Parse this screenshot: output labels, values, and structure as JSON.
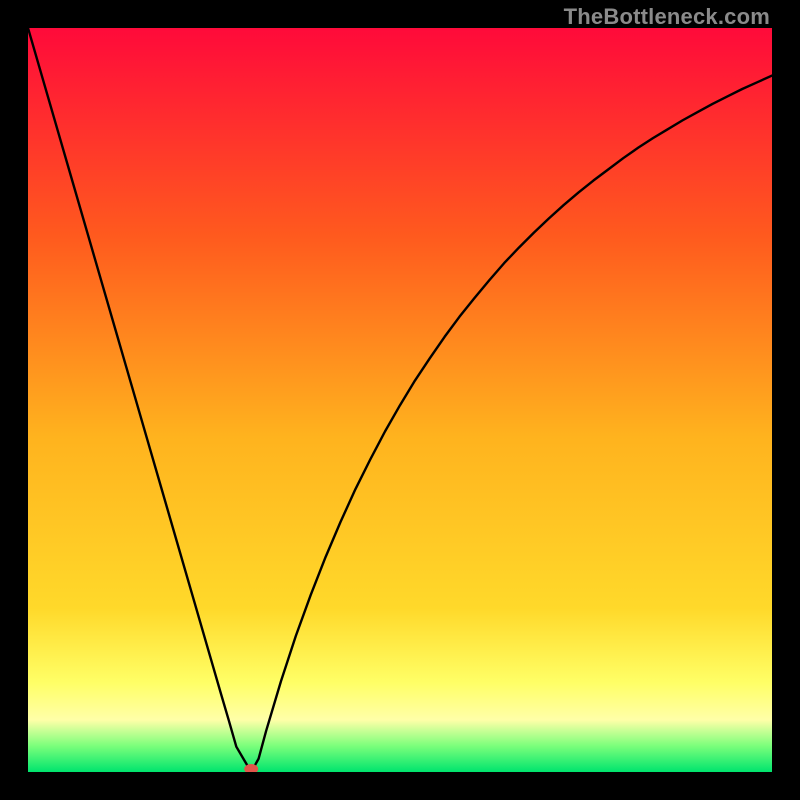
{
  "watermark": "TheBottleneck.com",
  "colors": {
    "top": "#ff0a3a",
    "midTop": "#ff8a1e",
    "mid": "#ffd92a",
    "yellowBand": "#ffff66",
    "yellowLight": "#ffffa8",
    "greenLight": "#7bff7b",
    "green": "#00e46e",
    "curve": "#000000",
    "marker": "#e2554a"
  },
  "chart_data": {
    "type": "line",
    "title": "",
    "xlabel": "",
    "ylabel": "",
    "xlim": [
      0,
      100
    ],
    "ylim": [
      0,
      100
    ],
    "grid": false,
    "legend": false,
    "annotations": [],
    "x": [
      0,
      2,
      4,
      6,
      8,
      10,
      12,
      14,
      16,
      18,
      20,
      22,
      24,
      26,
      27,
      28,
      29,
      30,
      31,
      32,
      34,
      36,
      38,
      40,
      42,
      44,
      46,
      48,
      50,
      52,
      54,
      56,
      58,
      60,
      62,
      64,
      66,
      68,
      70,
      72,
      74,
      76,
      78,
      80,
      82,
      84,
      86,
      88,
      90,
      92,
      94,
      96,
      98,
      100
    ],
    "y": [
      100,
      93.1,
      86.2,
      79.3,
      72.4,
      65.5,
      58.6,
      51.7,
      44.8,
      37.9,
      31.0,
      24.1,
      17.2,
      10.3,
      6.9,
      3.4,
      1.7,
      0.0,
      1.8,
      5.5,
      12.2,
      18.3,
      23.8,
      28.9,
      33.6,
      38.0,
      42.0,
      45.8,
      49.3,
      52.6,
      55.6,
      58.5,
      61.2,
      63.7,
      66.1,
      68.4,
      70.5,
      72.5,
      74.4,
      76.2,
      77.9,
      79.5,
      81.0,
      82.5,
      83.9,
      85.2,
      86.4,
      87.6,
      88.7,
      89.8,
      90.8,
      91.8,
      92.7,
      93.6
    ],
    "marker": {
      "x": 30,
      "y": 0,
      "color": "#e2554a"
    }
  }
}
